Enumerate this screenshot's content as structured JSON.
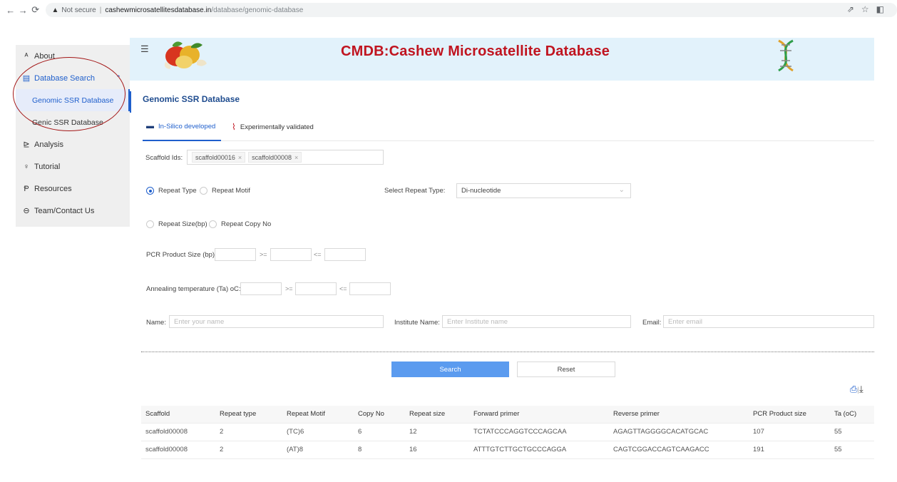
{
  "browser": {
    "security": "Not secure",
    "host": "cashewmicrosatellitesdatabase.in",
    "path": "/database/genomic-database"
  },
  "sidebar": {
    "items": [
      {
        "label": "About",
        "icon": "user-icon"
      },
      {
        "label": "Database Search",
        "icon": "database-icon"
      },
      {
        "label": "Genomic SSR Database"
      },
      {
        "label": "Genic SSR Database"
      },
      {
        "label": "Analysis",
        "icon": "chart-icon"
      },
      {
        "label": "Tutorial",
        "icon": "bulb-icon"
      },
      {
        "label": "Resources",
        "icon": "resources-icon"
      },
      {
        "label": "Team/Contact Us",
        "icon": "contact-icon"
      }
    ]
  },
  "header": {
    "title": "CMDB:Cashew Microsatellite Database",
    "title_color": "#c0141f",
    "banner_color": "#e2f2fb"
  },
  "page": {
    "title": "Genomic SSR Database",
    "accent": "#1f5fcc"
  },
  "tabs": [
    {
      "label": "In-Silico developed",
      "icon": "monitor-icon",
      "active": true
    },
    {
      "label": "Experimentally validated",
      "icon": "test-tube-icon",
      "active": false
    }
  ],
  "form": {
    "scaffold_label": "Scaffold Ids:",
    "scaffold_tags": [
      "scaffold00016",
      "scaffold00008"
    ],
    "repeat_type_radio": "Repeat Type",
    "repeat_motif_radio": "Repeat Motif",
    "select_repeat_label": "Select Repeat Type:",
    "select_repeat_value": "Di-nucleotide",
    "repeat_size_radio": "Repeat Size(bp)",
    "repeat_copy_radio": "Repeat Copy No",
    "pcr_label": "PCR Product Size (bp):",
    "annealing_label": "Annealing temperature (Ta) oC:",
    "gte": ">=",
    "lte": "<=",
    "name_label": "Name:",
    "name_placeholder": "Enter your name",
    "institute_label": "Institute Name:",
    "institute_placeholder": "Enter Institute name",
    "email_label": "Email:",
    "email_placeholder": "Enter email"
  },
  "buttons": {
    "search": "Search",
    "reset": "Reset"
  },
  "table": {
    "columns": [
      "Scaffold",
      "Repeat type",
      "Repeat Motif",
      "Copy No",
      "Repeat size",
      "Forward primer",
      "Reverse primer",
      "PCR Product size",
      "Ta (oC)"
    ],
    "rows": [
      [
        "scaffold00008",
        "2",
        "(TC)6",
        "6",
        "12",
        "TCTATCCCAGGTCCCAGCAA",
        "AGAGTTAGGGGCACATGCAC",
        "107",
        "55"
      ],
      [
        "scaffold00008",
        "2",
        "(AT)8",
        "8",
        "16",
        "ATTTGTCTTGCTGCCCAGGA",
        "CAGTCGGACCAGTCAAGACC",
        "191",
        "55"
      ]
    ]
  }
}
